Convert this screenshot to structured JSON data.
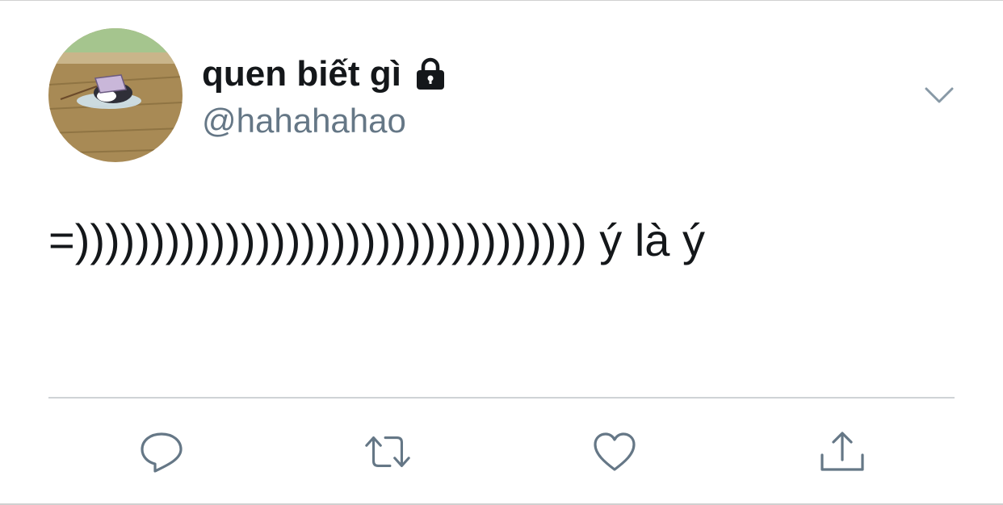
{
  "tweet": {
    "display_name": "quen biết gì",
    "handle": "@hahahahao",
    "text": "=)))))))))))))))))))))))))))))))))) ý là ý"
  },
  "icons": {
    "lock": "lock-icon",
    "caret": "chevron-down-icon",
    "reply": "reply-icon",
    "retweet": "retweet-icon",
    "like": "heart-icon",
    "share": "share-icon"
  },
  "colors": {
    "text_primary": "#14171a",
    "text_secondary": "#657786",
    "icon": "#657786",
    "divider": "#cfd3d6"
  }
}
